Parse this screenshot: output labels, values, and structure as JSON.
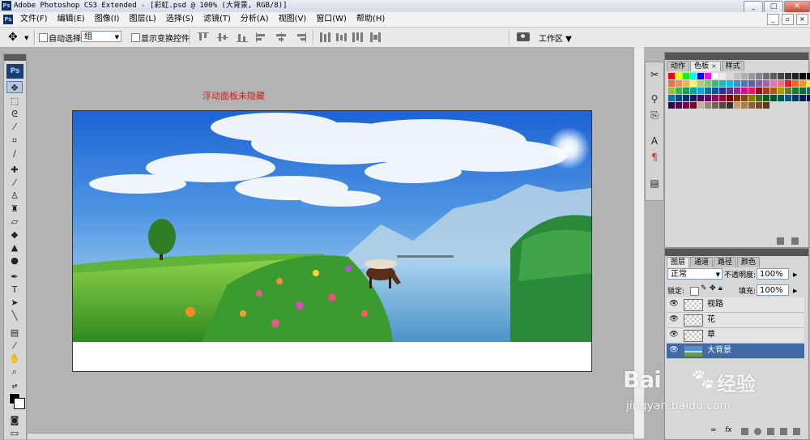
{
  "window": {
    "title": "Adobe Photoshop CS3 Extended - [彩虹.psd @ 100% (大背景, RGB/8)]",
    "controls": [
      "_",
      "□",
      "✕"
    ]
  },
  "menubar": {
    "items": [
      "文件(F)",
      "编辑(E)",
      "图像(I)",
      "图层(L)",
      "选择(S)",
      "滤镜(T)",
      "分析(A)",
      "视图(V)",
      "窗口(W)",
      "帮助(H)"
    ]
  },
  "options": {
    "auto_select_label": "自动选择:",
    "auto_select_value": "组",
    "show_transform_label": "显示变换控件",
    "workspace_label": "工作区 ▼"
  },
  "canvas": {
    "note": "浮动面板未隐藏"
  },
  "swatches_panel": {
    "tabs": [
      "动作",
      "色板",
      "样式"
    ],
    "active_tab": "色板",
    "colors": [
      "#ff0000",
      "#ffff00",
      "#00ff00",
      "#00ffff",
      "#0000ff",
      "#ff00ff",
      "#ffffff",
      "#ebebeb",
      "#d6d6d6",
      "#c2c2c2",
      "#adadad",
      "#999999",
      "#858585",
      "#707070",
      "#5c5c5c",
      "#474747",
      "#333333",
      "#1f1f1f",
      "#0a0a0a",
      "#000000",
      "#f26c4f",
      "#f68e56",
      "#fbaf5d",
      "#fff568",
      "#acd372",
      "#7cc576",
      "#3bb878",
      "#1abbb4",
      "#00bff3",
      "#438ccb",
      "#5574b9",
      "#605ca8",
      "#855fa8",
      "#a763a8",
      "#f06ea9",
      "#f26d7d",
      "#ed1c24",
      "#f26522",
      "#f7941d",
      "#fff200",
      "#8dc63f",
      "#39b54a",
      "#00a651",
      "#00a99d",
      "#00aeef",
      "#0072bc",
      "#0054a6",
      "#2e3192",
      "#662d91",
      "#92278f",
      "#ec008c",
      "#ed145b",
      "#9e0b0f",
      "#a0410d",
      "#a36209",
      "#aba000",
      "#598527",
      "#1a7b30",
      "#007236",
      "#00746b",
      "#0076a3",
      "#004b80",
      "#003471",
      "#1b1464",
      "#440e62",
      "#630460",
      "#9e005d",
      "#9e0039",
      "#790000",
      "#7b2e00",
      "#7d4900",
      "#827b00",
      "#406618",
      "#005e20",
      "#005826",
      "#005952",
      "#005b7f",
      "#003663",
      "#002157",
      "#0d004c",
      "#32004b",
      "#4b0049",
      "#7b0046",
      "#7a0026",
      "#c7b299",
      "#998675",
      "#736357",
      "#534741",
      "#37302d",
      "#c69c6d",
      "#a67c52",
      "#8c6239",
      "#754c24",
      "#603913"
    ]
  },
  "layers_panel": {
    "tabs": [
      "图层",
      "通道",
      "路径",
      "颜色"
    ],
    "blend_mode": "正常",
    "opacity_label": "不透明度:",
    "opacity_value": "100%",
    "lock_label": "锁定:",
    "fill_label": "填充:",
    "fill_value": "100%",
    "layers": [
      {
        "name": "视路",
        "selected": false
      },
      {
        "name": "花",
        "selected": false
      },
      {
        "name": "草",
        "selected": false
      },
      {
        "name": "大背景",
        "selected": true
      }
    ]
  },
  "watermark": {
    "brand": "Bai",
    "brand_cn": "经验",
    "url": "jingyan.baidu.com"
  }
}
